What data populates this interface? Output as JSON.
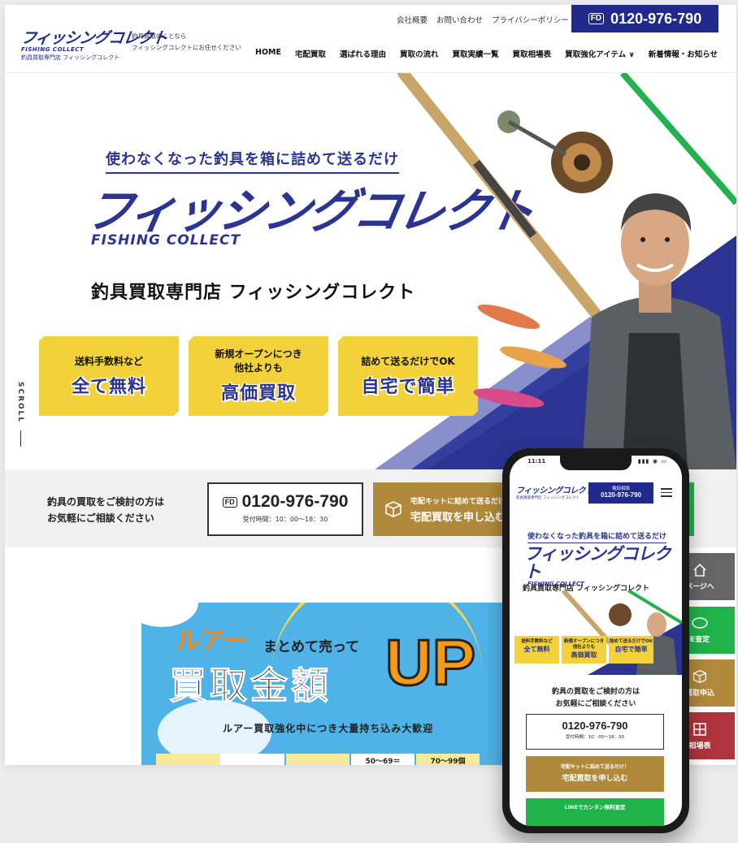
{
  "header": {
    "logo_jp": "フィッシングコレクト",
    "logo_en": "FISHING COLLECT",
    "logo_sub": "釣具買取専門店 フィッシングコレクト",
    "tagline_1": "釣具買取のことなら",
    "tagline_2": "フィッシングコレクトにお任せください",
    "top_links": [
      "会社概要",
      "お問い合わせ",
      "プライバシーポリシー"
    ],
    "phone_icon": "free-dial-icon",
    "phone_icon_text": "FD",
    "phone": "0120-976-790",
    "nav": [
      "HOME",
      "宅配買取",
      "選ばれる理由",
      "買取の流れ",
      "買取実績一覧",
      "買取相場表",
      "買取強化アイテム",
      "新着情報・お知らせ"
    ]
  },
  "hero": {
    "tagline": "使わなくなった釣具を箱に詰めて送るだけ",
    "logo_jp": "フィッシングコレクト",
    "logo_en": "FISHING COLLECT",
    "shop_name": "釣具買取専門店 フィッシングコレクト",
    "badges": [
      {
        "small_1": "送料手数料など",
        "small_2": "",
        "big": "全て無料"
      },
      {
        "small_1": "新規オープンにつき",
        "small_2": "他社よりも",
        "big": "高価買取"
      },
      {
        "small_1": "詰めて送るだけでOK",
        "small_2": "",
        "big": "自宅で簡単"
      }
    ],
    "scroll_label": "SCROLL"
  },
  "cta": {
    "text_1": "釣具の買取をご検討の方は",
    "text_2": "お気軽にご相談ください",
    "phone_icon_text": "FD",
    "phone": "0120-976-790",
    "hours": "受付時間：10：00〜18：30",
    "box_line_1": "宅配キットに詰めて送るだけ！",
    "box_line_2": "宅配買取を申し込む"
  },
  "banner": {
    "lure": "ルアー",
    "matomete": "まとめて売って",
    "kingaku": "買取金額",
    "up": "UP",
    "sub": "ルアー買取強化中につき大量持ち込み大歓迎",
    "table": [
      "",
      "",
      "",
      "50〜69＝",
      "70〜99個",
      ""
    ]
  },
  "side_buttons": [
    {
      "label": "ページへ",
      "icon": "home-icon",
      "color": "#666666"
    },
    {
      "label": "E査定",
      "icon": "line-icon",
      "color": "#1fb34a"
    },
    {
      "label": "買取申込",
      "icon": "box-icon",
      "color": "#b08a3a"
    },
    {
      "label": "相場表",
      "icon": "table-icon",
      "color": "#b0343c"
    }
  ],
  "phone_mockup": {
    "time": "11:11",
    "signal": "▮▮▮ ◉ ▭",
    "logo_jp": "フィッシングコレクト",
    "logo_sub": "釣具買取専門店 フィッシングコレクト",
    "header_phone_label": "電話相談",
    "header_phone": "0120-976-790",
    "tagline": "使わなくなった釣具を箱に詰めて送るだけ",
    "big_logo_jp": "フィッシングコレクト",
    "big_logo_en": "FISHING COLLECT",
    "shop_name": "釣具買取専門店 フィッシングコレクト",
    "badges": [
      {
        "small": "送料手数料など",
        "big": "全て無料"
      },
      {
        "small": "新規オープンにつき 他社よりも",
        "big": "高価買取"
      },
      {
        "small": "詰めて送るだけでOK",
        "big": "自宅で簡単"
      }
    ],
    "cta_text_1": "釣具の買取をご検討の方は",
    "cta_text_2": "お気軽にご相談ください",
    "cta_phone": "0120-976-790",
    "cta_hours": "受付時間：10：00〜18：30",
    "cta_box_1": "宅配キットに詰めて送るだけ！",
    "cta_box_2": "宅配買取を申し込む",
    "line_label": "LINEでカンタン無料査定"
  },
  "colors": {
    "brand_navy": "#1f2a8a",
    "badge_yellow": "#f3d13a",
    "cta_gold": "#b08a3a",
    "line_green": "#1fb34a"
  }
}
